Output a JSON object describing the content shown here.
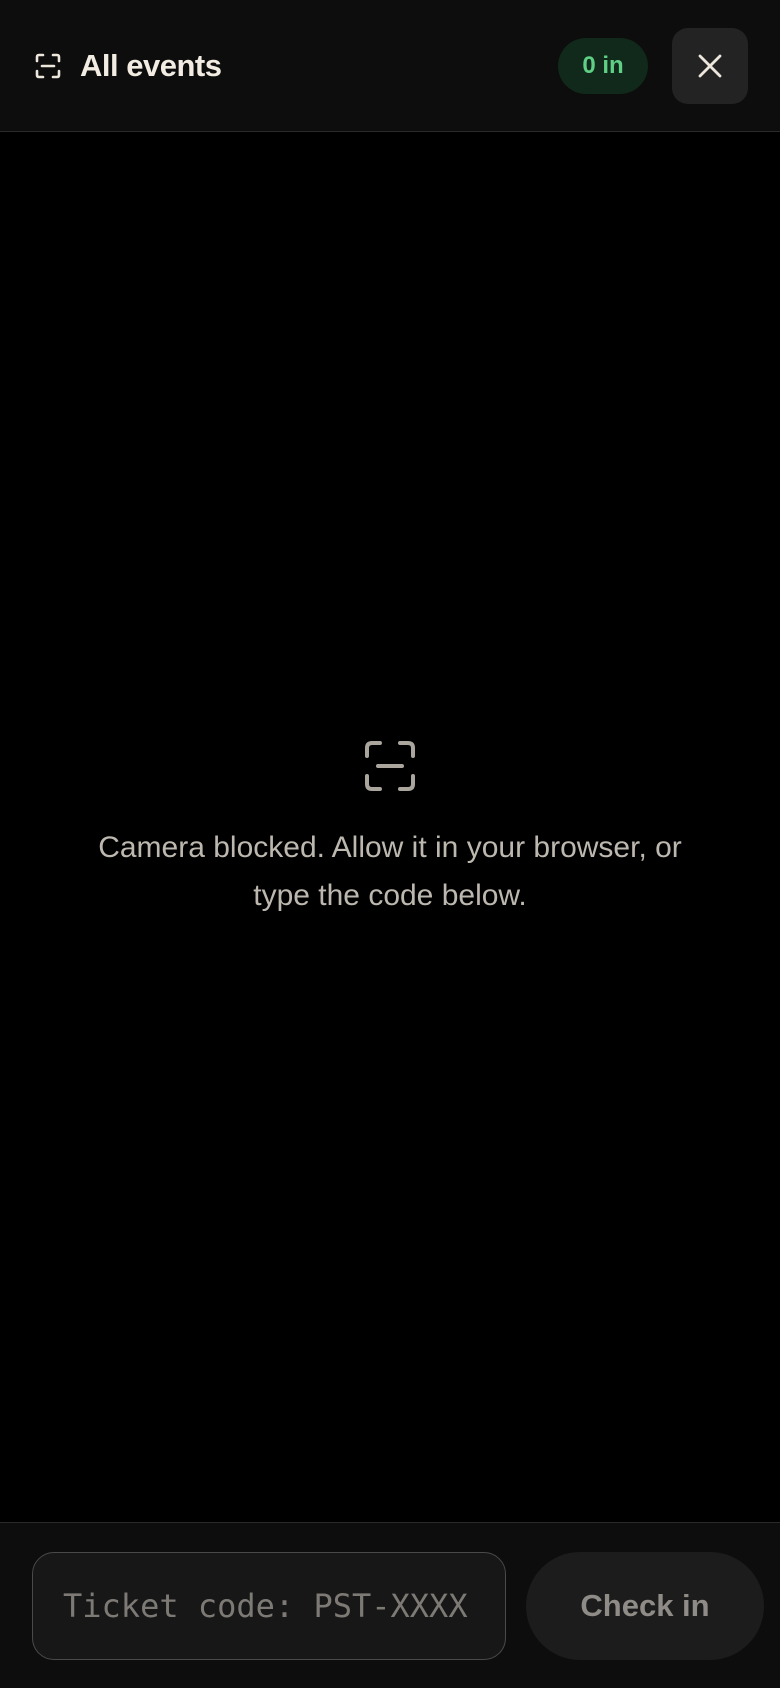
{
  "header": {
    "title": "All events",
    "icon": "scan-icon",
    "checked_in_badge": "0 in",
    "close_icon": "close-icon"
  },
  "camera": {
    "icon": "scan-icon",
    "message": "Camera blocked. Allow it in your browser, or type the code below."
  },
  "footer": {
    "ticket_input_placeholder": "Ticket code: PST-XXXX",
    "ticket_input_value": "",
    "check_in_label": "Check in"
  },
  "colors": {
    "background": "#000000",
    "header_background": "#0d0d0d",
    "badge_background": "#10291a",
    "badge_text": "#5fcf86",
    "button_background": "#1c1c1c"
  }
}
